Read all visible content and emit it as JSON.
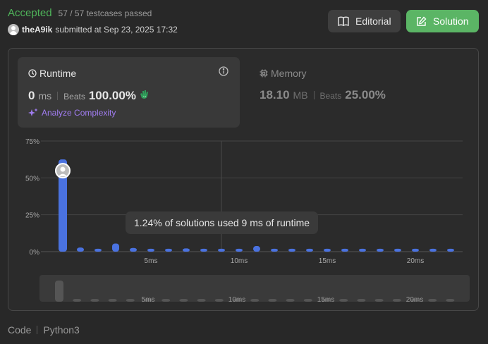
{
  "header": {
    "status": "Accepted",
    "testcases": "57 / 57 testcases passed",
    "username": "theA9ik",
    "submitted_text": "submitted at Sep 23, 2025 17:32"
  },
  "buttons": {
    "editorial_label": "Editorial",
    "solution_label": "Solution"
  },
  "runtime": {
    "title": "Runtime",
    "value": "0",
    "unit": "ms",
    "beats_label": "Beats",
    "beats_value": "100.00%",
    "analyze_label": "Analyze Complexity"
  },
  "memory": {
    "title": "Memory",
    "value": "18.10",
    "unit": "MB",
    "beats_label": "Beats",
    "beats_value": "25.00%"
  },
  "tooltip": {
    "text": "1.24% of solutions used 9 ms of runtime"
  },
  "footer": {
    "code_label": "Code",
    "language": "Python3"
  },
  "colors": {
    "accepted": "#4fb55a",
    "bar": "#4a72e0",
    "solution_button": "#5bb565",
    "analyze": "#a07cf0"
  },
  "chart_data": {
    "type": "bar",
    "x": [
      0,
      1,
      2,
      3,
      4,
      5,
      6,
      7,
      8,
      9,
      10,
      11,
      12,
      13,
      14,
      15,
      16,
      17,
      18,
      19,
      20,
      21,
      22
    ],
    "values": [
      62.5,
      2.8,
      2.0,
      5.5,
      2.5,
      2.0,
      2.0,
      2.2,
      2.0,
      2.0,
      2.0,
      3.8,
      2.0,
      2.0,
      2.0,
      2.0,
      2.0,
      2.0,
      2.0,
      2.0,
      2.0,
      2.0,
      2.0
    ],
    "highlight_index": 0,
    "y_ticks": [
      "75%",
      "50%",
      "25%",
      "0%"
    ],
    "y_tick_values": [
      75,
      50,
      25,
      0
    ],
    "ylim": [
      0,
      75
    ],
    "x_ticks": [
      "5ms",
      "10ms",
      "15ms",
      "20ms"
    ],
    "x_tick_values": [
      5,
      10,
      15,
      20
    ],
    "hover_x": 9,
    "grid": true
  }
}
